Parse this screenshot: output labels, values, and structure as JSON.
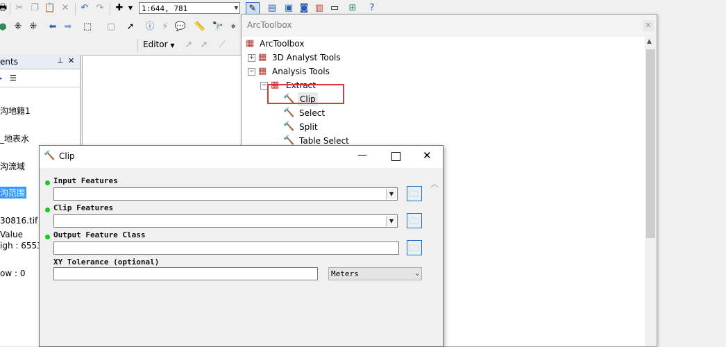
{
  "toolbar": {
    "scale_value": "1:644, 781",
    "editor_label": "Editor"
  },
  "toc": {
    "title_fragment": "ents",
    "items": [
      {
        "label": "沟地籍1"
      },
      {
        "label": "_地表水"
      },
      {
        "label": "沟流域"
      },
      {
        "label": "沟范围"
      },
      {
        "label": "30816.tif -"
      },
      {
        "label": "Value"
      },
      {
        "label": "igh : 6553"
      },
      {
        "label": "ow : 0"
      }
    ]
  },
  "arctoolbox": {
    "window_title": "ArcToolbox",
    "tree": {
      "root": "ArcToolbox",
      "items": [
        {
          "label": "3D Analyst Tools"
        },
        {
          "label": "Analysis Tools"
        },
        {
          "label": "Extract"
        },
        {
          "label": "Clip"
        },
        {
          "label": "Select"
        },
        {
          "label": "Split"
        },
        {
          "label": "Table Select"
        }
      ]
    },
    "highlight_color": "#e0343a"
  },
  "clip_dialog": {
    "title": "Clip",
    "fields": {
      "input_features_label": "Input Features",
      "input_features_value": "",
      "clip_features_label": "Clip Features",
      "clip_features_value": "",
      "output_label": "Output Feature Class",
      "output_value": "",
      "xy_tolerance_label": "XY Tolerance (optional)",
      "xy_tolerance_value": "",
      "units_value": "Meters"
    }
  }
}
